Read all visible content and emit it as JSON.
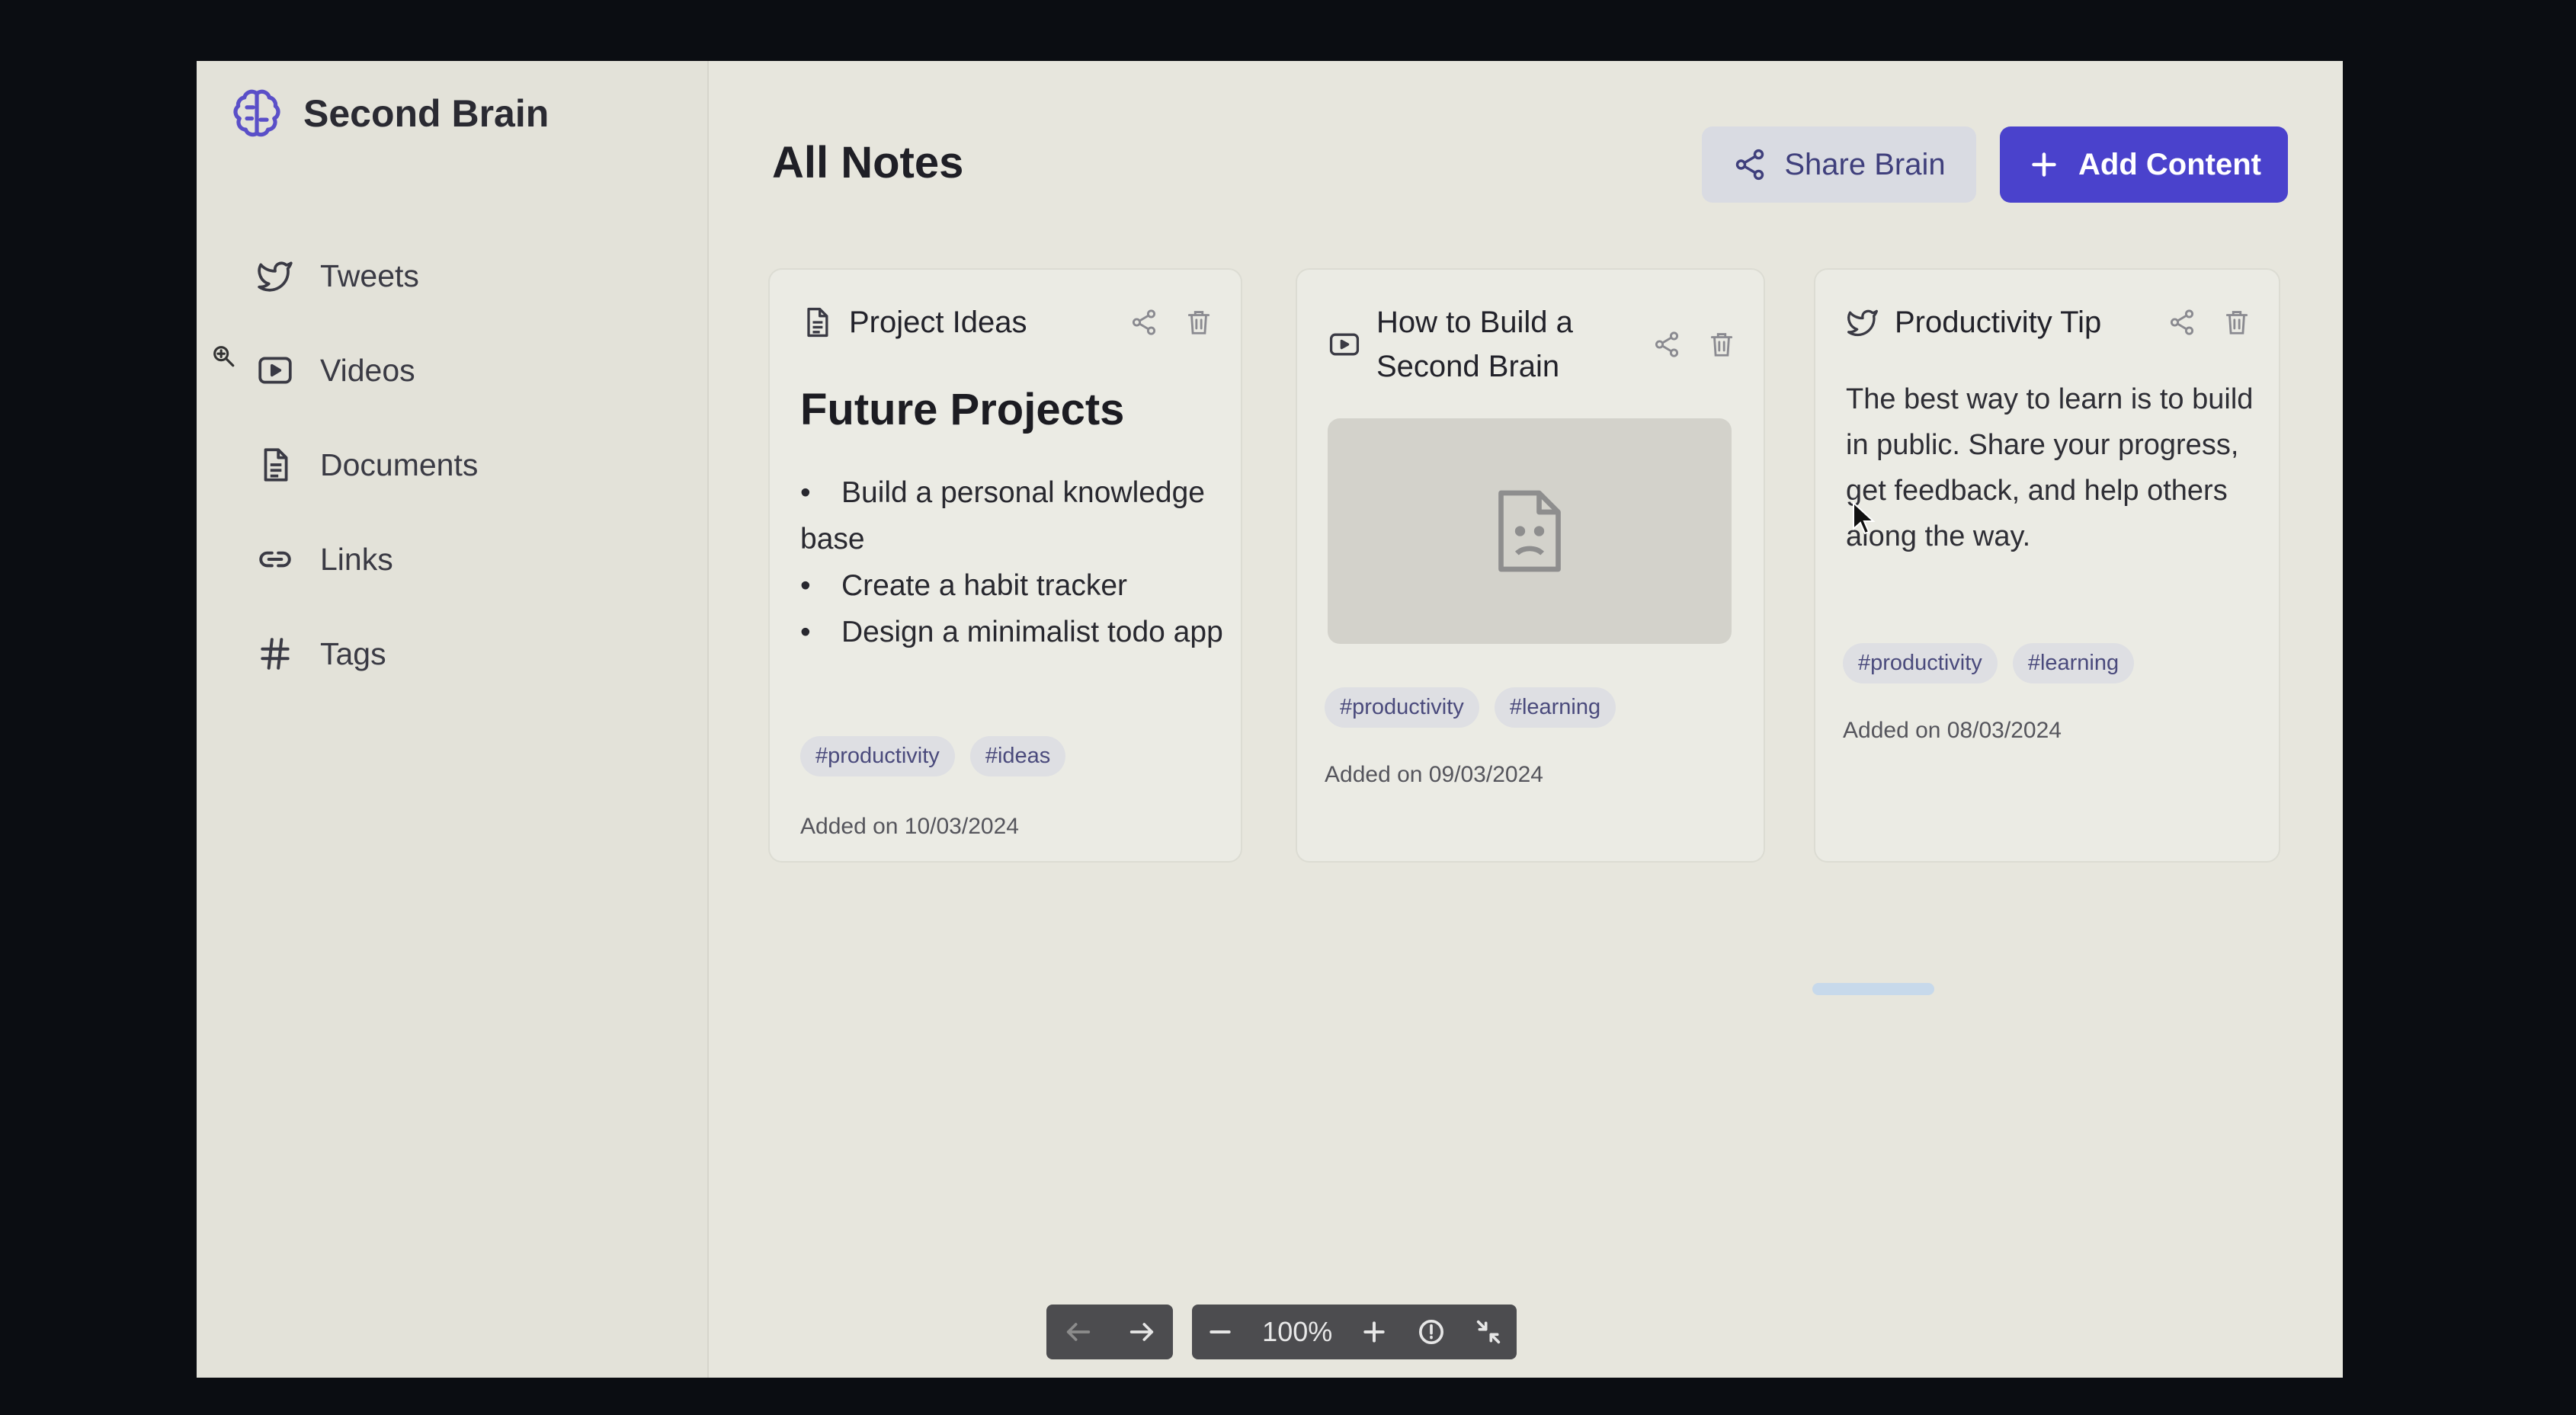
{
  "app": {
    "name": "Second Brain",
    "brand_icon": "brain-icon"
  },
  "sidebar": {
    "items": [
      {
        "label": "Tweets",
        "icon": "twitter-icon"
      },
      {
        "label": "Videos",
        "icon": "video-icon"
      },
      {
        "label": "Documents",
        "icon": "document-icon"
      },
      {
        "label": "Links",
        "icon": "link-icon"
      },
      {
        "label": "Tags",
        "icon": "hash-icon"
      }
    ]
  },
  "header": {
    "title": "All Notes",
    "share_label": "Share Brain",
    "add_label": "Add Content"
  },
  "cards": [
    {
      "type_icon": "document-icon",
      "title": "Project Ideas",
      "heading": "Future Projects",
      "items": [
        "Build a personal knowledge base",
        "Create a habit tracker",
        "Design a minimalist todo app"
      ],
      "tags": [
        "#productivity",
        "#ideas"
      ],
      "added": "Added on 10/03/2024"
    },
    {
      "type_icon": "video-icon",
      "title": "How to Build a Second Brain",
      "media": "broken-file-icon",
      "tags": [
        "#productivity",
        "#learning"
      ],
      "added": "Added on 09/03/2024"
    },
    {
      "type_icon": "twitter-icon",
      "title": "Productivity Tip",
      "text": "The best way to learn is to build in public. Share your progress, get feedback, and help others along the way.",
      "tags": [
        "#productivity",
        "#learning"
      ],
      "added": "Added on 08/03/2024"
    }
  ],
  "toolbar": {
    "zoom": "100%"
  },
  "colors": {
    "accent": "#4a42cc",
    "sidebar_bg": "#e3e2d9",
    "main_bg": "#e7e6dd"
  }
}
